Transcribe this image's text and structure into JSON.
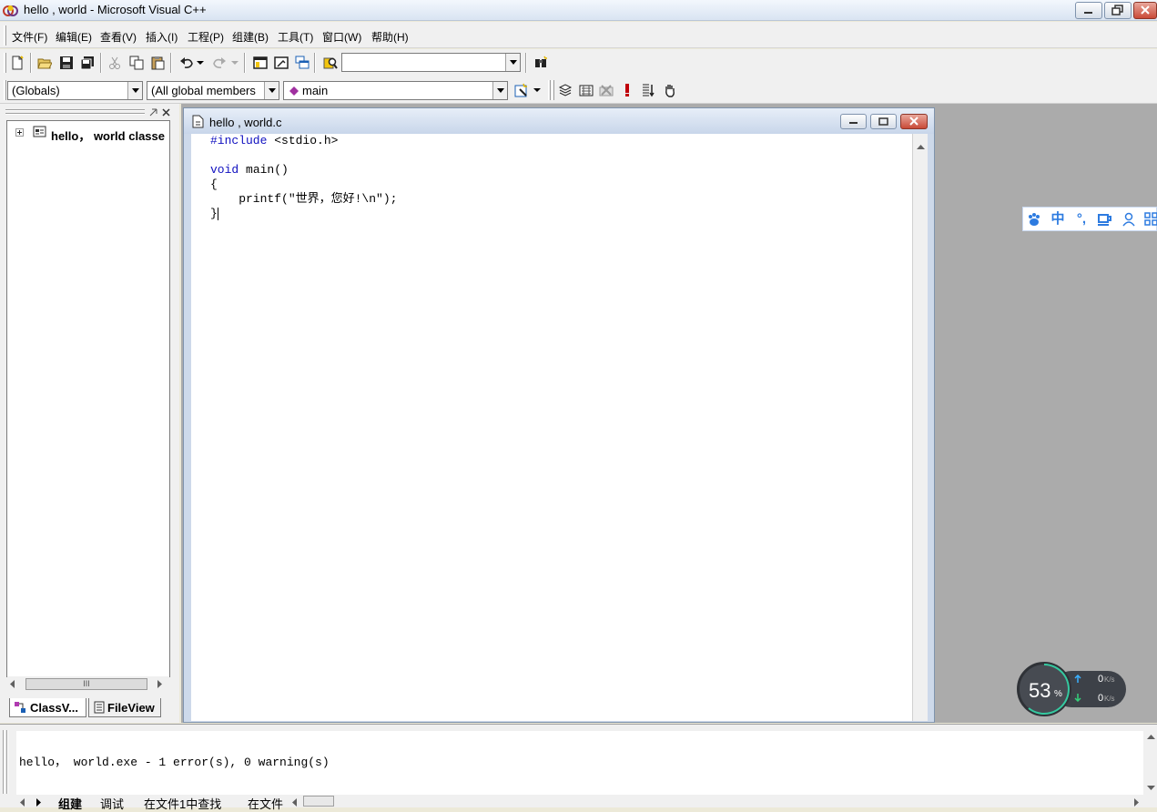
{
  "window": {
    "title": "hello , world - Microsoft Visual C++"
  },
  "menu": [
    "文件(F)",
    "编辑(E)",
    "查看(V)",
    "插入(I)",
    "工程(P)",
    "组建(B)",
    "工具(T)",
    "窗口(W)",
    "帮助(H)"
  ],
  "wizard_bar": {
    "scope": "(Globals)",
    "members": "(All global members",
    "function": "main"
  },
  "workspace": {
    "tree_root": "hello， world classe",
    "tabs": [
      "ClassV...",
      "FileView"
    ],
    "hscroll_thumb": "III"
  },
  "editor": {
    "title": "hello , world.c",
    "code": [
      {
        "kw": "#include",
        "rest": " <stdio.h>"
      },
      {
        "kw": "",
        "rest": ""
      },
      {
        "kw": "void",
        "rest": " main()"
      },
      {
        "kw": "",
        "rest": "{"
      },
      {
        "kw": "",
        "rest": "    printf(\"世界，您好!\\n\");"
      },
      {
        "kw": "",
        "rest": "}"
      }
    ]
  },
  "output": {
    "text": "hello， world.exe - 1 error(s), 0 warning(s)",
    "tabs": [
      "组建",
      "调试",
      "在文件1中查找",
      "在文件"
    ]
  },
  "ime": {
    "items": [
      "中",
      "°,"
    ]
  },
  "net_widget": {
    "percent": "53",
    "percent_unit": "%",
    "up": "0",
    "down": "0",
    "unit": "K/s"
  }
}
